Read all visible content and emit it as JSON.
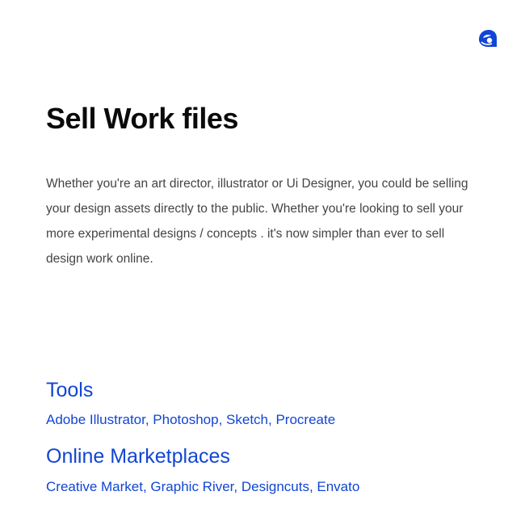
{
  "page": {
    "title": "Sell Work files",
    "description": "Whether you're an art director, illustrator or Ui Designer, you could be selling your design assets directly to the public. Whether you're looking to sell your more experimental designs / concepts . it's now simpler than ever to sell design work online."
  },
  "tools": {
    "heading": "Tools",
    "list": "Adobe Illustrator, Photoshop, Sketch, Procreate"
  },
  "marketplaces": {
    "heading": "Online Marketplaces",
    "list": "Creative Market, Graphic River, Designcuts, Envato"
  },
  "logo": {
    "icon": "brand-logo-icon"
  },
  "colors": {
    "accent": "#1146d4",
    "text": "#0a0a0a",
    "body": "#444444",
    "background": "#ffffff"
  }
}
